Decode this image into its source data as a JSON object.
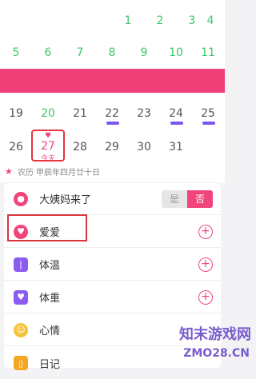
{
  "calendar": {
    "row1": [
      "1",
      "2",
      "3",
      "4"
    ],
    "row2": [
      "5",
      "6",
      "7",
      "8",
      "9",
      "10",
      "11"
    ],
    "row4": [
      "19",
      "20",
      "21",
      "22",
      "23",
      "24",
      "25"
    ],
    "row5": [
      "26",
      "27",
      "28",
      "29",
      "30",
      "31"
    ],
    "today_label": "今天",
    "lunar": "农历 甲辰年四月廿十日"
  },
  "records": {
    "period_label": "大姨妈来了",
    "yes": "是",
    "no": "否",
    "love_label": "爱爱",
    "temperature_label": "体温",
    "weight_label": "体重",
    "mood_label": "心情",
    "diary_label": "日记"
  },
  "watermark": {
    "line1": "知末游戏网",
    "line2": "ZMO28.CN"
  }
}
